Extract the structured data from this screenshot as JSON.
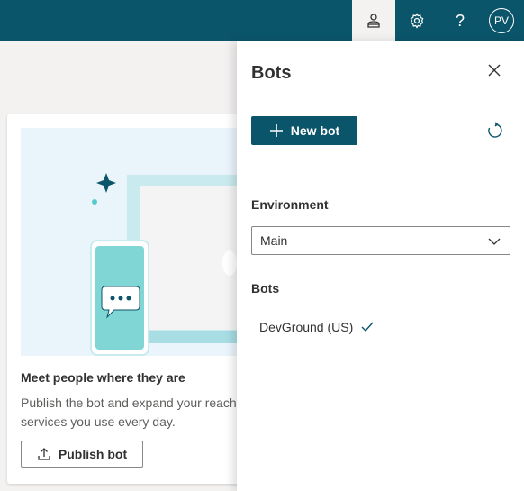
{
  "header": {
    "icons": [
      "bot-person-icon",
      "gear-icon",
      "help-icon"
    ],
    "user_initials": "PV",
    "colors": {
      "bar": "#0b556a"
    }
  },
  "card": {
    "title": "Meet people where they are",
    "description": "Publish the bot and expand your reach services you use every day.",
    "publish_label": "Publish bot"
  },
  "panel": {
    "title": "Bots",
    "new_bot_label": "New bot",
    "environment_label": "Environment",
    "environment_value": "Main",
    "bots_label": "Bots",
    "bots": [
      {
        "name": "DevGround (US)",
        "selected": true
      }
    ],
    "accent": "#0b556a"
  }
}
